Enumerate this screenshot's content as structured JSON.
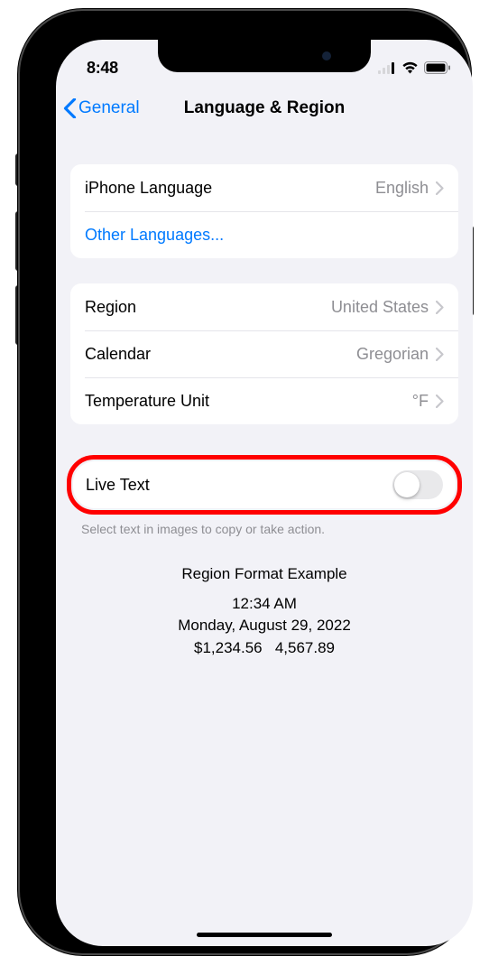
{
  "status": {
    "time": "8:48"
  },
  "nav": {
    "back_label": "General",
    "title": "Language & Region"
  },
  "language_section": {
    "iphone_language": {
      "label": "iPhone Language",
      "value": "English"
    },
    "other_languages": {
      "label": "Other Languages..."
    }
  },
  "region_section": {
    "region": {
      "label": "Region",
      "value": "United States"
    },
    "calendar": {
      "label": "Calendar",
      "value": "Gregorian"
    },
    "temperature": {
      "label": "Temperature Unit",
      "value": "°F"
    }
  },
  "live_text": {
    "label": "Live Text",
    "enabled": false,
    "description": "Select text in images to copy or take action."
  },
  "example": {
    "title": "Region Format Example",
    "time": "12:34 AM",
    "date": "Monday, August 29, 2022",
    "currency": "$1,234.56",
    "number": "4,567.89"
  }
}
